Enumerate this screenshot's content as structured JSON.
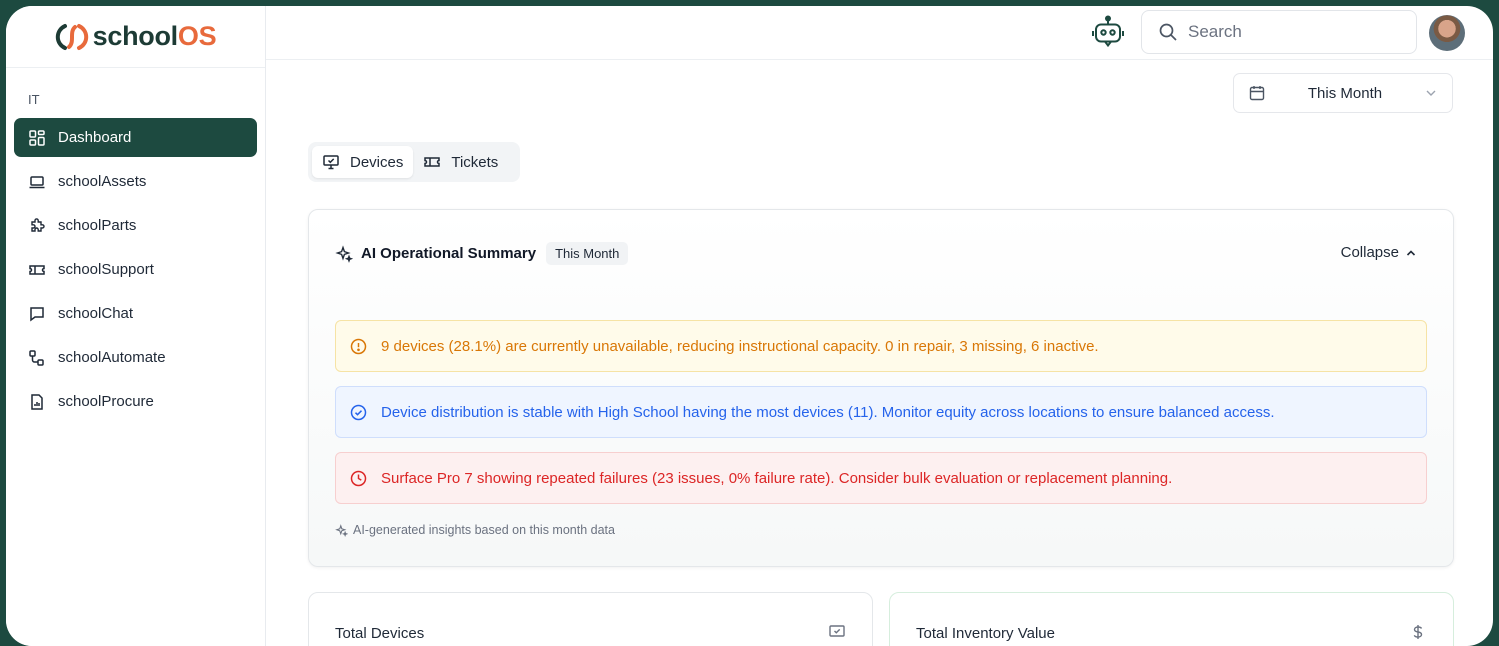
{
  "brand": {
    "name_prefix": "school",
    "name_suffix": "OS"
  },
  "sidebar": {
    "section_label": "IT",
    "items": [
      {
        "label": "Dashboard",
        "icon": "grid-icon",
        "active": true
      },
      {
        "label": "schoolAssets",
        "icon": "laptop-icon"
      },
      {
        "label": "schoolParts",
        "icon": "puzzle-icon"
      },
      {
        "label": "schoolSupport",
        "icon": "ticket-icon"
      },
      {
        "label": "schoolChat",
        "icon": "chat-icon"
      },
      {
        "label": "schoolAutomate",
        "icon": "workflow-icon"
      },
      {
        "label": "schoolProcure",
        "icon": "document-icon"
      }
    ]
  },
  "header": {
    "search_placeholder": "Search"
  },
  "date_filter": {
    "label": "This Month"
  },
  "tabs": [
    {
      "label": "Devices",
      "active": true
    },
    {
      "label": "Tickets"
    }
  ],
  "summary": {
    "title": "AI Operational Summary",
    "period": "This Month",
    "collapse_label": "Collapse",
    "alerts": [
      {
        "type": "warning",
        "text": "9 devices (28.1%) are currently unavailable, reducing instructional capacity. 0 in repair, 3 missing, 6 inactive."
      },
      {
        "type": "info",
        "text": "Device distribution is stable with High School having the most devices (11). Monitor equity across locations to ensure balanced access."
      },
      {
        "type": "error",
        "text": "Surface Pro 7 showing repeated failures (23 issues, 0% failure rate). Consider bulk evaluation or replacement planning."
      }
    ],
    "footnote": "AI-generated insights based on this month data"
  },
  "stats": [
    {
      "label": "Total Devices",
      "icon": "device-check-icon"
    },
    {
      "label": "Total Inventory Value",
      "icon": "dollar-icon"
    }
  ],
  "colors": {
    "primary": "#1d4a40",
    "brand_accent": "#e86a3c",
    "warning": "#d97706",
    "info": "#2563eb",
    "error": "#dc2626"
  }
}
